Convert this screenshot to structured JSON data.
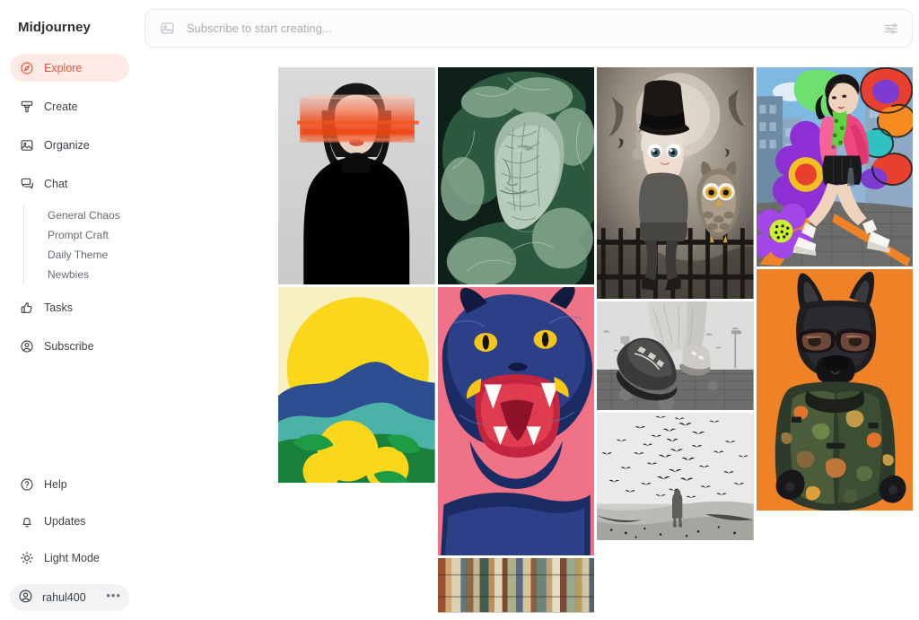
{
  "brand": {
    "name": "Midjourney"
  },
  "colors": {
    "accent": "#e8543a",
    "accent_bg": "#fdeae6",
    "sidebar_bg": "#ffffff",
    "text": "#3c4045",
    "muted": "#646a72"
  },
  "sidebar": {
    "items": [
      {
        "label": "Explore",
        "icon": "compass-icon",
        "active": true
      },
      {
        "label": "Create",
        "icon": "brush-icon",
        "active": false
      },
      {
        "label": "Organize",
        "icon": "image-icon",
        "active": false
      },
      {
        "label": "Chat",
        "icon": "chat-icon",
        "active": false
      }
    ],
    "chat_channels": [
      {
        "label": "General Chaos"
      },
      {
        "label": "Prompt Craft"
      },
      {
        "label": "Daily Theme"
      },
      {
        "label": "Newbies"
      }
    ],
    "items_after": [
      {
        "label": "Tasks",
        "icon": "thumbs-up-icon"
      },
      {
        "label": "Subscribe",
        "icon": "user-circle-icon"
      }
    ],
    "bottom_items": [
      {
        "label": "Help",
        "icon": "question-circle-icon"
      },
      {
        "label": "Updates",
        "icon": "bell-icon"
      },
      {
        "label": "Light Mode",
        "icon": "sun-icon"
      }
    ],
    "user": {
      "name": "rahul400",
      "icon": "user-circle-icon",
      "menu": "•••"
    }
  },
  "search": {
    "placeholder": "Subscribe to start creating...",
    "value": "",
    "left_icon": "image-icon",
    "right_icon": "sliders-icon"
  },
  "gallery": {
    "columns": [
      {
        "tiles": [
          {
            "name": "woman-orange-glitch-portrait",
            "ratio": "0.72",
            "alt": "Portrait of a woman with black bob haircut and orange motion-blur band over her eyes"
          },
          {
            "name": "yellow-sun-lemons-poster",
            "ratio": "0.80",
            "alt": "Graphic poster of a large yellow sun over blue mountains with lemons and green leaves"
          }
        ]
      },
      {
        "tiles": [
          {
            "name": "cabbage-face-sculpture",
            "ratio": "0.72",
            "alt": "Face sculpted from green savoy cabbage leaves"
          },
          {
            "name": "blue-panther-roar",
            "ratio": "0.58",
            "alt": "Blue panther roaring with yellow fangs on pink background"
          },
          {
            "name": "bookshelf-spines",
            "ratio": "0.30",
            "alt": "Row of colorful antique book spines"
          }
        ]
      },
      {
        "tiles": [
          {
            "name": "girl-tophat-owl-fence",
            "ratio": "0.68",
            "alt": "Girl in a top hat sitting with an owl on an iron fence under a full moon"
          },
          {
            "name": "sneaker-step-lowangle",
            "ratio": "0.34",
            "alt": "Low angle black and white photo of a sneaker stepping on wet cobblestones"
          },
          {
            "name": "birds-flock-figure",
            "ratio": "0.40",
            "alt": "Black and white photo of a lone figure amid a flock of birds"
          }
        ]
      },
      {
        "tiles": [
          {
            "name": "pink-blazer-street-pop",
            "ratio": "0.63",
            "alt": "Woman in pink blazer walking on a street with purple pop-art flowers"
          },
          {
            "name": "dog-sunglasses-orange",
            "ratio": "0.75",
            "alt": "Black dog wearing sunglasses and a camo jacket on orange background"
          }
        ]
      }
    ]
  }
}
